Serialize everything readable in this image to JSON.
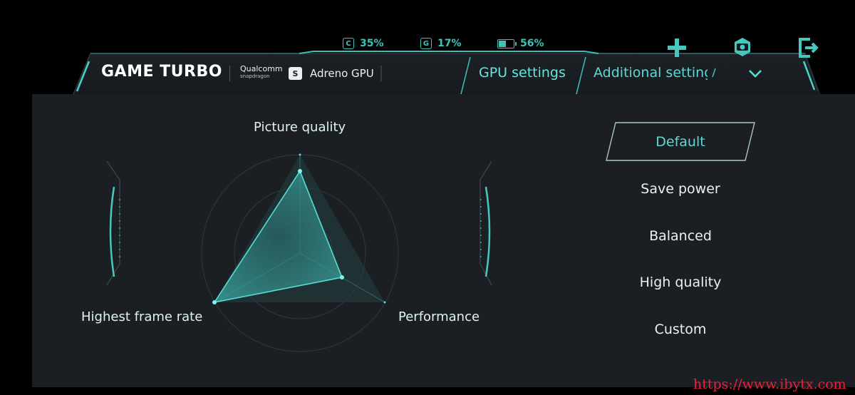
{
  "status": {
    "cpu": {
      "icon": "C",
      "value": "35%"
    },
    "gpu": {
      "icon": "G",
      "value": "17%"
    },
    "battery": {
      "value": "56%"
    }
  },
  "top_icons": [
    "plus-icon",
    "camera-gear-icon",
    "exit-icon"
  ],
  "header": {
    "brand": "GAME TURBO",
    "chip_brand": "Qualcomm",
    "chip_sub": "snapdragon",
    "snap_logo": "S",
    "gpu_name": "Adreno GPU",
    "tabs": [
      {
        "label": "GPU settings",
        "active": true
      },
      {
        "label": "Additional settings",
        "active": false
      }
    ]
  },
  "radar": {
    "axes": [
      "Picture quality",
      "Performance",
      "Highest frame rate"
    ],
    "levels": {
      "picture_quality": 0.85,
      "performance": 0.55,
      "highest_frame_rate": 1.0
    }
  },
  "modes": {
    "selected": "Default",
    "items": [
      "Default",
      "Save power",
      "Balanced",
      "High quality",
      "Custom"
    ]
  },
  "colors": {
    "accent": "#57ddd6",
    "panel": "#1b1f24",
    "status": "#3ec3b8"
  },
  "watermark": "https://www.ibytx.com"
}
